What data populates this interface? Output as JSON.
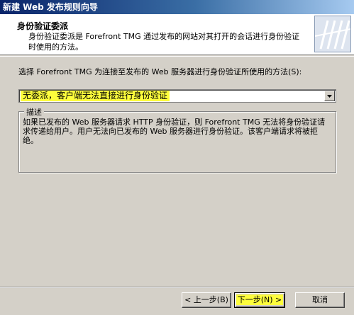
{
  "window": {
    "title": "新建 Web 发布规则向导"
  },
  "header": {
    "title": "身份验证委派",
    "description": "身份验证委派是 Forefront TMG 通过发布的网站对其打开的会话进行身份验证时使用的方法。"
  },
  "main": {
    "prompt": "选择 Forefront TMG 为连接至发布的 Web 服务器进行身份验证所使用的方法(S):",
    "dropdown": {
      "selected": "无委派，客户端无法直接进行身份验证"
    },
    "group": {
      "legend": "描述",
      "text": "如果已发布的 Web 服务器请求 HTTP 身份验证，则 Forefront TMG 无法将身份验证请求传递给用户。用户无法向已发布的 Web 服务器进行身份验证。该客户端请求将被拒绝。"
    }
  },
  "footer": {
    "back_label": "< 上一步(B)",
    "next_label": "下一步(N) >",
    "cancel_label": "取消"
  },
  "colors": {
    "highlight": "#fdfd3c",
    "title_gradient_start": "#0a246a"
  }
}
